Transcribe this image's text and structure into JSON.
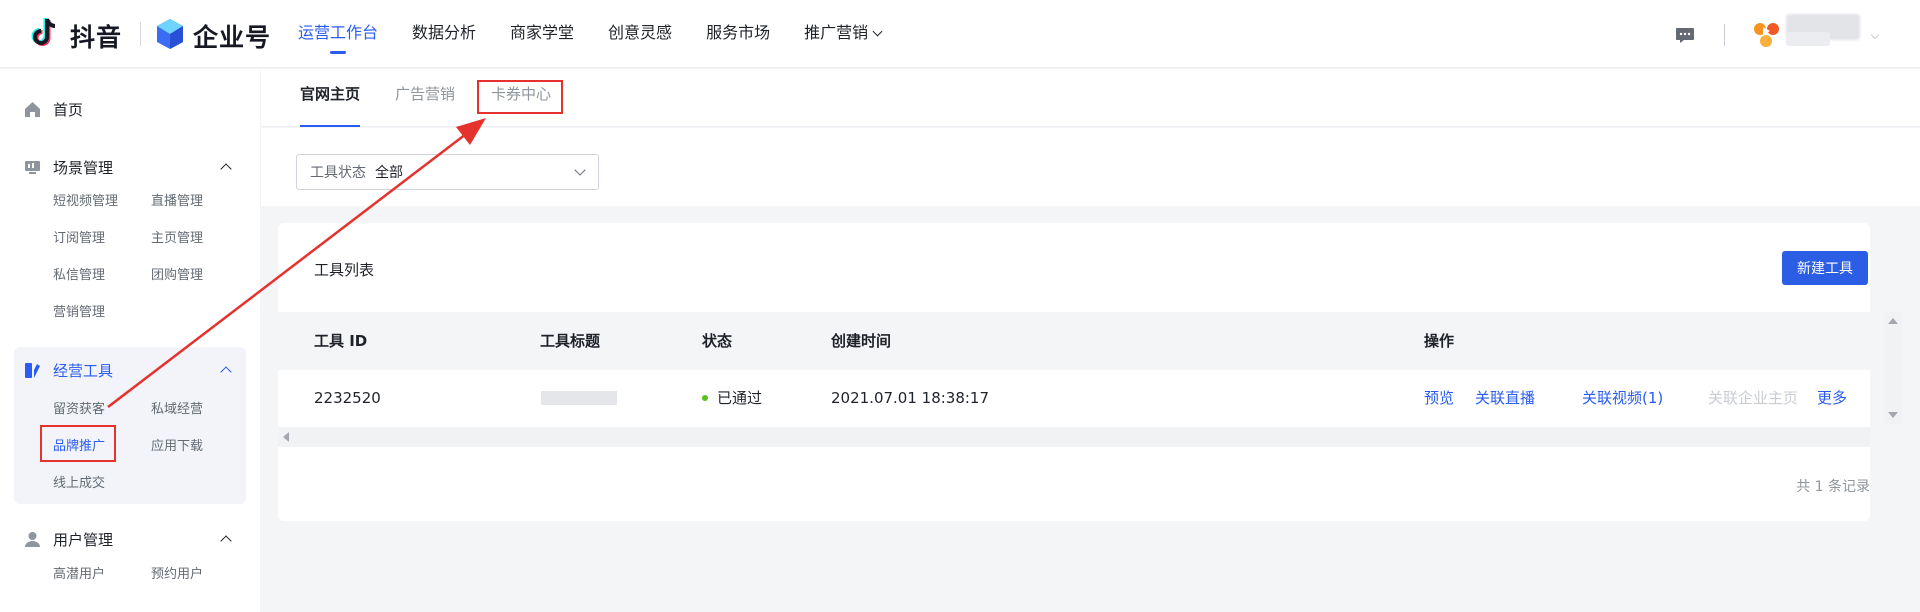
{
  "header": {
    "douyin_logo_text": "抖音",
    "enterprise_logo_text": "企业号",
    "nav": [
      {
        "label": "运营工作台",
        "active": true
      },
      {
        "label": "数据分析",
        "active": false
      },
      {
        "label": "商家学堂",
        "active": false
      },
      {
        "label": "创意灵感",
        "active": false
      },
      {
        "label": "服务市场",
        "active": false
      },
      {
        "label": "推广营销",
        "active": false,
        "dropdown": true
      }
    ],
    "icons": {
      "message": "message-icon",
      "account": "account-logo-icon"
    }
  },
  "sidebar": {
    "home": "首页",
    "sections": [
      {
        "title": "场景管理",
        "items": [
          "短视频管理",
          "直播管理",
          "订阅管理",
          "主页管理",
          "私信管理",
          "团购管理",
          "营销管理"
        ]
      },
      {
        "title": "经营工具",
        "items": [
          "留资获客",
          "私域经营",
          "品牌推广",
          "应用下载",
          "线上成交"
        ]
      },
      {
        "title": "用户管理",
        "items": [
          "高潜用户",
          "预约用户"
        ]
      }
    ]
  },
  "tabs": [
    "官网主页",
    "广告营销",
    "卡券中心"
  ],
  "filter": {
    "label": "工具状态",
    "value": "全部"
  },
  "card": {
    "title": "工具列表",
    "new_button": "新建工具",
    "columns": [
      "工具 ID",
      "工具标题",
      "状态",
      "创建时间",
      "操作"
    ],
    "rows": [
      {
        "id": "2232520",
        "status": "已通过",
        "created": "2021.07.01 18:38:17",
        "actions": [
          "预览",
          "关联直播",
          "关联视频(1)",
          "关联企业主页",
          "更多"
        ]
      }
    ],
    "total": "共 1 条记录"
  },
  "colors": {
    "accent": "#2b5cf0",
    "highlight": "#e5322d",
    "status_ok": "#52c41a"
  }
}
